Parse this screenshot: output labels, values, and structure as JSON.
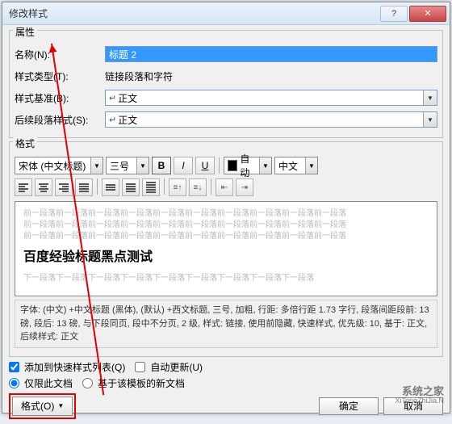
{
  "titlebar": {
    "title": "修改样式"
  },
  "properties": {
    "group_title": "属性",
    "name_label": "名称(N):",
    "name_value": "标题 2",
    "type_label": "样式类型(T):",
    "type_value": "链接段落和字符",
    "base_label": "样式基准(B):",
    "base_value": "正文",
    "next_label": "后续段落样式(S):",
    "next_value": "正文"
  },
  "format": {
    "group_title": "格式",
    "font": "宋体 (中文标题)",
    "size": "三号",
    "auto": "自动",
    "lang": "中文",
    "bold": "B",
    "italic": "I",
    "underline": "U"
  },
  "preview": {
    "filler": "前一段落前一段落前一段落前一段落前一段落前一段落前一段落前一段落前一段落前一段落",
    "main": "百度经验标题黑点测试",
    "filler2": "下一段落下一段落下一段落下一段落下一段落下一段落下一段落下一段落下一段落"
  },
  "description": "字体: (中文) +中文标题 (黑体), (默认) +西文标题, 三号, 加粗, 行距: 多倍行距 1.73 字行, 段落间距段前: 13 磅, 段后: 13 磅, 与下段同页, 段中不分页, 2 级, 样式: 链接, 使用前隐藏, 快速样式, 优先级: 10, 基于: 正文, 后续样式: 正文",
  "checkboxes": {
    "add_quick": "添加到快速样式列表(Q)",
    "auto_update": "自动更新(U)",
    "this_doc": "仅限此文档",
    "template": "基于该模板的新文档"
  },
  "buttons": {
    "format": "格式(O)",
    "ok": "确定",
    "cancel": "取消"
  },
  "watermark": {
    "name": "系统之家",
    "url": "XiTongZhiJia.N"
  }
}
